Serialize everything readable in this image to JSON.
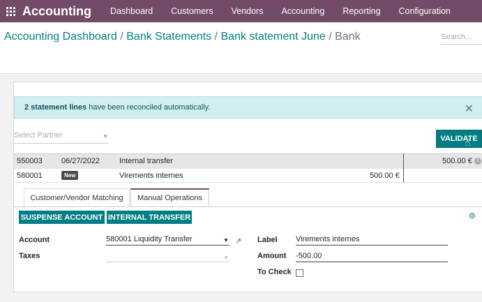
{
  "navbar": {
    "brand": "Accounting",
    "items": [
      "Dashboard",
      "Customers",
      "Vendors",
      "Accounting",
      "Reporting",
      "Configuration"
    ]
  },
  "breadcrumb": {
    "crumbs": [
      "Accounting Dashboard",
      "Bank Statements",
      "Bank statement June"
    ],
    "current": "Bank",
    "separator": "/"
  },
  "search": {
    "placeholder": "Search..."
  },
  "alert": {
    "bold": "2 statement lines",
    "rest": "have been reconciled automatically.",
    "close": "✕"
  },
  "partner": {
    "placeholder": "Select Partner"
  },
  "validate_label": "VALIDATE",
  "lines": [
    {
      "account": "550003",
      "date": "06/27/2022",
      "label": "Internal transfer",
      "amount": "",
      "amount_right": "500.00 €"
    },
    {
      "account": "580001",
      "badge": "New",
      "label": "Virements internes",
      "amount": "500.00 €"
    }
  ],
  "tabs": [
    "Customer/Vendor Matching",
    "Manual Operations"
  ],
  "active_tab": "Manual Operations",
  "buttons": {
    "suspense": "SUSPENSE ACCOUNT",
    "internal": "INTERNAL TRANSFER"
  },
  "form": {
    "account_label": "Account",
    "account_value": "580001 Liquidity Transfer",
    "taxes_label": "Taxes",
    "label_label": "Label",
    "label_value": "Virements internes",
    "amount_label": "Amount",
    "amount_value": "-500.00",
    "to_check_label": "To Check"
  },
  "colors": {
    "navbar": "#714b67",
    "primary": "#017e84",
    "alert_bg": "#d3eef0"
  }
}
